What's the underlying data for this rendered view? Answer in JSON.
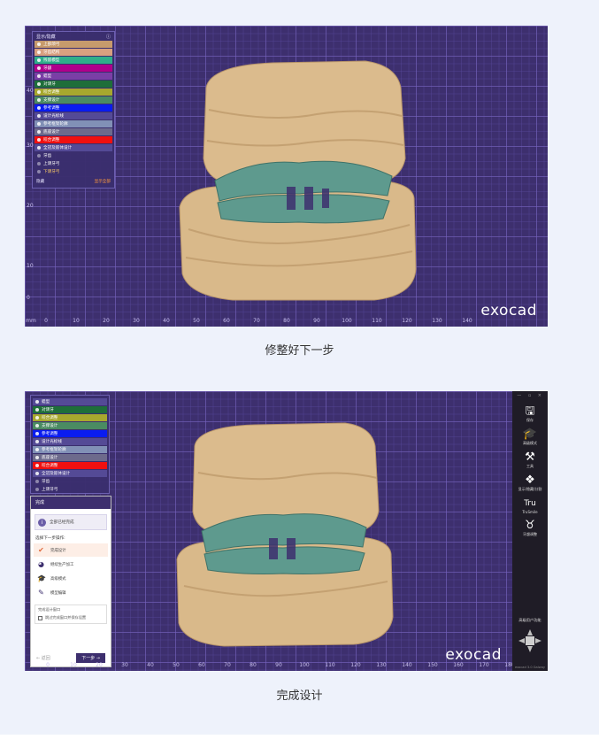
{
  "captions": [
    "修整好下一步",
    "完成设计"
  ],
  "logo": "exocad",
  "ruler": {
    "unit": "mm",
    "x_ticks_1": [
      "0",
      "10",
      "20",
      "30",
      "40",
      "50",
      "60",
      "70",
      "80",
      "90",
      "100",
      "110",
      "120",
      "130",
      "140"
    ],
    "y_ticks_1": [
      "40",
      "30",
      "20",
      "10",
      "0"
    ],
    "x_ticks_2": [
      "0",
      "10",
      "20",
      "30",
      "40",
      "50",
      "60",
      "70",
      "80",
      "90",
      "100",
      "110",
      "120",
      "130",
      "140",
      "150",
      "160",
      "170",
      "180"
    ]
  },
  "panel1": {
    "header": "显示/隐藏",
    "help_icon": "question-icon",
    "layers": [
      {
        "label": "上部颌弓",
        "color": "#c79a6c"
      },
      {
        "label": "牙齿结构",
        "color": "#d8a080"
      },
      {
        "label": "残留模型",
        "color": "#2fae8a"
      },
      {
        "label": "牙龈",
        "color": "#b0008c"
      },
      {
        "label": "蜡型",
        "color": "#7a3fa6"
      },
      {
        "label": "对颌牙",
        "color": "#1e6e3a"
      },
      {
        "label": "咬合调整",
        "color": "#a7a82e"
      },
      {
        "label": "支撑设计",
        "color": "#4a8b62"
      },
      {
        "label": "参考调整",
        "color": "#0a1cf0"
      },
      {
        "label": "设计光标线",
        "color": "#544a96"
      },
      {
        "label": "参考框架轮廓",
        "color": "#8190b6"
      },
      {
        "label": "底座设计",
        "color": "#6d6a8c"
      },
      {
        "label": "咬合调整",
        "color": "#f01010"
      },
      {
        "label": "全冠及嵌体设计",
        "color": "#544a96"
      }
    ],
    "groups": [
      "牙齿",
      "上颌牙弓",
      "下颌牙弓"
    ],
    "footer_left": "隐藏",
    "footer_right": "显示全部"
  },
  "panel2": {
    "layers": [
      {
        "label": "蜡型",
        "color": "#544a96"
      },
      {
        "label": "对颌牙",
        "color": "#1e6e3a"
      },
      {
        "label": "咬合调整",
        "color": "#a7a82e"
      },
      {
        "label": "支撑设计",
        "color": "#4a8b62"
      },
      {
        "label": "参考调整",
        "color": "#0a1cf0"
      },
      {
        "label": "设计光标线",
        "color": "#544a96"
      },
      {
        "label": "参考框架轮廓",
        "color": "#8190b6"
      },
      {
        "label": "底座设计",
        "color": "#6d6a8c"
      },
      {
        "label": "咬合调整",
        "color": "#f01010"
      },
      {
        "label": "全冠及嵌体设计",
        "color": "#544a96"
      }
    ],
    "groups": [
      "牙齿",
      "上颌牙弓"
    ]
  },
  "wizard": {
    "title": "完成",
    "done_note": "全部已经完成",
    "question": "选择下一步操作:",
    "options": [
      {
        "label": "完成设计",
        "icon": "check-icon"
      },
      {
        "label": "继续生产加工",
        "icon": "mill-icon"
      },
      {
        "label": "高级模式",
        "icon": "graduation-cap-icon"
      },
      {
        "label": "模型编辑",
        "icon": "edit-icon"
      }
    ],
    "box_title": "完成设计窗口",
    "box_checkbox": "跳过完成窗口并保存设置",
    "back": "← 返回",
    "next": "下一步 →"
  },
  "toolbar": {
    "window_buttons": "— ▫ ×",
    "tools": [
      {
        "label": "保存",
        "icon": "save-icon",
        "glyph": "🖫"
      },
      {
        "label": "高级模式",
        "icon": "graduation-cap-icon",
        "glyph": "🎓"
      },
      {
        "label": "工具",
        "icon": "tools-icon",
        "glyph": "⚒"
      },
      {
        "label": "显示/隐藏/分割",
        "icon": "layers-icon",
        "glyph": "❖"
      },
      {
        "label": "TruSmile",
        "icon": "trusmile-icon",
        "glyph": "Tru"
      },
      {
        "label": "牙龈调整",
        "icon": "tooth-icon",
        "glyph": "♉"
      }
    ],
    "expert": "高级用户功能",
    "version": "exocad 3.0 Galway"
  },
  "colors": {
    "viewport": "#3d2f6e",
    "model_tan": "#d9b98a",
    "tooth_green": "#5e9a8e"
  }
}
